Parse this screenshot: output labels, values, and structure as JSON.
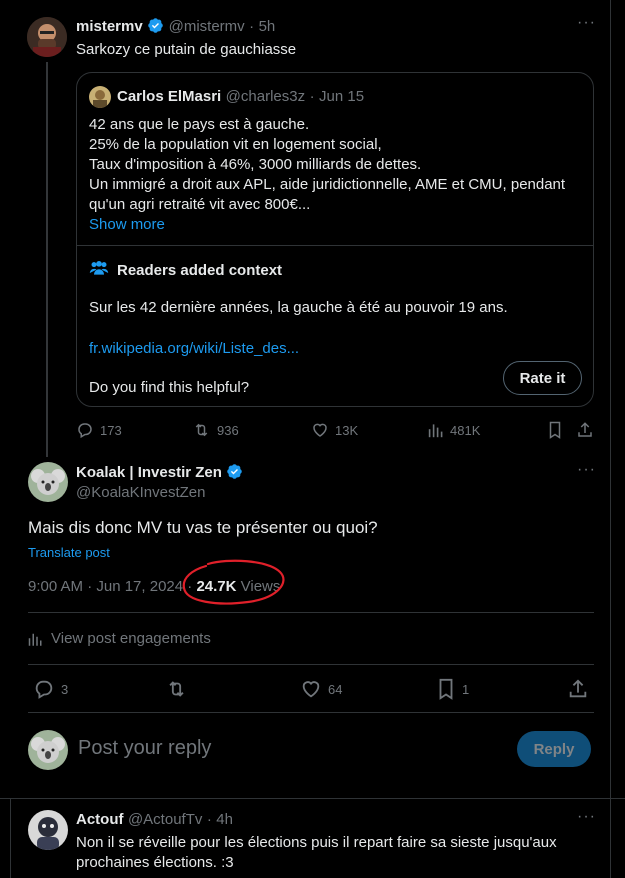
{
  "main_post": {
    "author_name": "mistermv",
    "author_handle": "@mistermv",
    "time": "5h",
    "text": "Sarkozy ce putain de gauchiasse",
    "quote": {
      "author_name": "Carlos ElMasri",
      "author_handle": "@charles3z",
      "time": "Jun 15",
      "lines": [
        "42 ans que le pays est à gauche.",
        "25% de la population vit en logement social,",
        "Taux d'imposition à 46%, 3000 milliards de dettes.",
        "Un immigré a droit aux APL, aide juridictionnelle, AME et CMU, pendant",
        "qu'un agri retraité vit avec 800€..."
      ],
      "show_more": "Show more",
      "context_title": "Readers added context",
      "context_text": "Sur les 42 dernière années, la gauche à été au pouvoir 19 ans.",
      "context_link": "fr.wikipedia.org/wiki/Liste_des...",
      "helpful_question": "Do you find this helpful?",
      "rate_button": "Rate it"
    },
    "stats": {
      "replies": "173",
      "reposts": "936",
      "likes": "13K",
      "views": "481K"
    }
  },
  "focused_post": {
    "author_name": "Koalak | Investir Zen",
    "author_handle": "@KoalaKInvestZen",
    "text": "Mais dis donc MV tu vas te présenter ou quoi?",
    "translate": "Translate post",
    "timestamp": "9:00 AM · Jun 17, 2024 · ",
    "views_count": "24.7K",
    "views_label": "Views",
    "engagements": "View post engagements",
    "stats": {
      "replies": "3",
      "likes": "64",
      "bookmarks": "1"
    }
  },
  "reply_box": {
    "placeholder": "Post your reply",
    "button": "Reply"
  },
  "reply_post": {
    "author_name": "Actouf",
    "author_handle": "@ActoufTv",
    "time": "4h",
    "text_line1": "Non il se réveille pour les élections puis il repart faire sa sieste jusqu'aux",
    "text_line2": "prochaines élections. :3"
  },
  "colors": {
    "accent": "#1d9bf0",
    "annotation": "#e0202a",
    "text": "#e7e9ea",
    "muted": "#71767b",
    "border": "#2f3336"
  }
}
